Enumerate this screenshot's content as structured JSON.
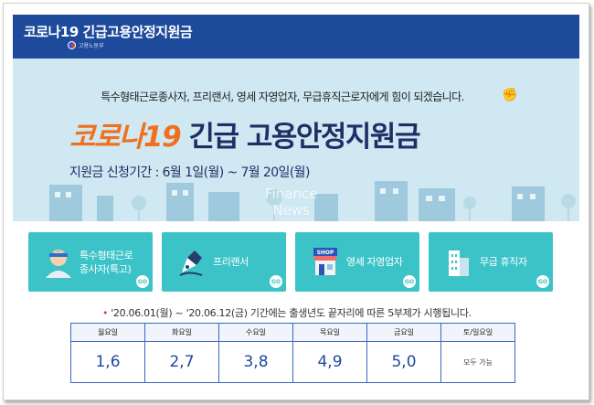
{
  "header": {
    "title": "코로나19 긴급고용안정지원금",
    "ministry": "고용노동부"
  },
  "banner": {
    "subtitle": "특수형태근로종사자, 프리랜서, 영세 자영업자, 무급휴직근로자에게 힘이 되겠습니다.",
    "headline_part1": "코로나19",
    "headline_part2": "긴급 고용안정지원금",
    "period": "지원금 신청기간 : 6월 1일(월) ~ 7월 20일(월)",
    "watermark_line1": "Finance",
    "watermark_line2": "News"
  },
  "cards": [
    {
      "label_line1": "특수형태근로",
      "label_line2": "종사자(특고)",
      "icon": "worker-icon",
      "go": "GO"
    },
    {
      "label_line1": "프리랜서",
      "label_line2": "",
      "icon": "pen-nib-icon",
      "go": "GO"
    },
    {
      "label_line1": "영세 자영업자",
      "label_line2": "",
      "icon": "shop-icon",
      "go": "GO",
      "shop_sign": "SHOP"
    },
    {
      "label_line1": "무급 휴직자",
      "label_line2": "",
      "icon": "building-icon",
      "go": "GO"
    }
  ],
  "note": {
    "bullet": "•",
    "text": "'20.06.01(월) ~ '20.06.12(금) 기간에는 출생년도 끝자리에 따른 5부제가 시행됩니다."
  },
  "schedule": {
    "headers": [
      "월요일",
      "화요일",
      "수요일",
      "목요일",
      "금요일",
      "토/일요일"
    ],
    "values": [
      "1,6",
      "2,7",
      "3,8",
      "4,9",
      "5,0",
      "모두 가능"
    ]
  },
  "colors": {
    "header_blue": "#1e4a9c",
    "banner_bg": "#cfe8f1",
    "card_teal": "#3cc3c8",
    "headline_orange": "#f0701e",
    "headline_navy": "#1f2f66"
  }
}
